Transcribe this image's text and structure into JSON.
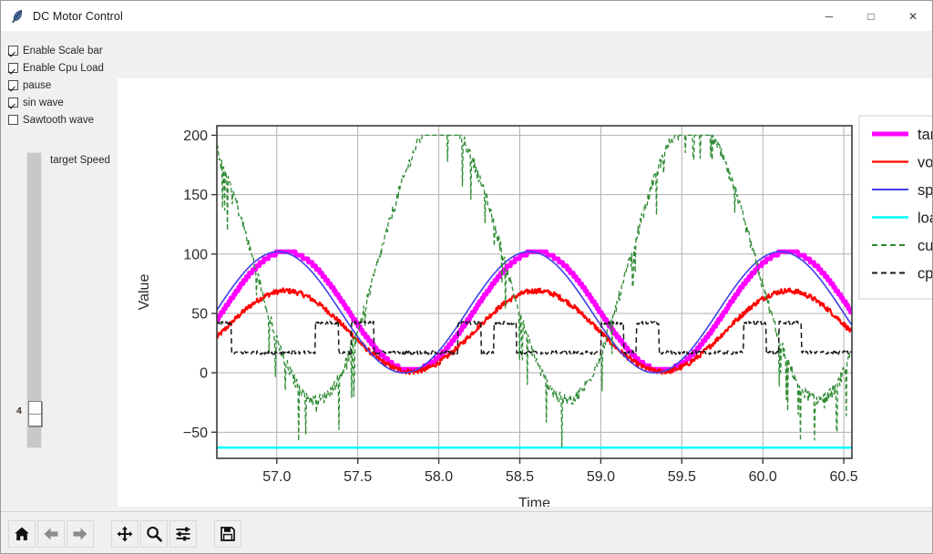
{
  "window": {
    "title": "DC Motor Control",
    "icon": "feather-icon",
    "minimize_glyph": "─",
    "maximize_glyph": "□",
    "close_glyph": "✕",
    "bg": "#f0f0f0"
  },
  "controls": {
    "checkboxes": [
      {
        "label": "Enable Scale bar",
        "checked": true,
        "name": "enable-scale-bar"
      },
      {
        "label": "Enable Cpu Load",
        "checked": true,
        "name": "enable-cpu-load"
      },
      {
        "label": "pause",
        "checked": true,
        "name": "pause"
      },
      {
        "label": "sin wave",
        "checked": true,
        "name": "sin-wave"
      },
      {
        "label": "Sawtooth wave",
        "checked": false,
        "name": "sawtooth-wave"
      }
    ],
    "scale": {
      "label": "target Speed",
      "value": "4",
      "orientation": "vertical"
    }
  },
  "toolbar": {
    "buttons": [
      {
        "name": "home-button",
        "icon": "home-icon",
        "tooltip": "Home"
      },
      {
        "name": "back-button",
        "icon": "arrow-left-icon",
        "tooltip": "Back"
      },
      {
        "name": "forward-button",
        "icon": "arrow-right-icon",
        "tooltip": "Forward"
      },
      {
        "name": "pan-button",
        "icon": "move-icon",
        "tooltip": "Pan"
      },
      {
        "name": "zoom-button",
        "icon": "magnifier-icon",
        "tooltip": "Zoom"
      },
      {
        "name": "configure-subplots-button",
        "icon": "sliders-icon",
        "tooltip": "Configure subplots"
      },
      {
        "name": "save-button",
        "icon": "floppy-disk-icon",
        "tooltip": "Save"
      }
    ]
  },
  "chart_data": {
    "type": "line",
    "title": "",
    "xlabel": "Time",
    "ylabel": "Value",
    "xlim": [
      56.63,
      60.55
    ],
    "ylim": [
      -72,
      208
    ],
    "xticks": [
      57.0,
      57.5,
      58.0,
      58.5,
      59.0,
      59.5,
      60.0,
      60.5
    ],
    "xticklabels": [
      "57.0",
      "57.5",
      "58.0",
      "58.5",
      "59.0",
      "59.5",
      "60.0",
      "60.5"
    ],
    "yticks": [
      -50,
      0,
      50,
      100,
      150,
      200
    ],
    "yticklabels": [
      "−50",
      "0",
      "50",
      "100",
      "150",
      "200"
    ],
    "grid": true,
    "grid_color": "#b0b0b0",
    "legend_position": "upper right (clipped at window edge)",
    "series": [
      {
        "name": "targetSpeed",
        "legend_label": "targetSpeed",
        "color": "#ff00ff",
        "style": "solid",
        "width": 5,
        "shape": "sine-stepped",
        "amplitude": 50,
        "offset": 52,
        "period": 1.55,
        "phase": 0.44,
        "quantize": 3
      },
      {
        "name": "voltage",
        "legend_label": "voltage",
        "color": "#ff0000",
        "style": "solid",
        "width": 2.2,
        "shape": "sine-noisy",
        "amplitude": 34,
        "offset": 35,
        "period": 1.55,
        "phase": 0.44,
        "noise": 2.2
      },
      {
        "name": "speed",
        "legend_label": "speed",
        "color": "#4040e8",
        "style": "solid",
        "width": 1.6,
        "shape": "sine",
        "amplitude": 51,
        "offset": 51,
        "period": 1.55,
        "phase": 0.47
      },
      {
        "name": "loadTorque",
        "legend_label": "loadTorque",
        "color": "#00ffff",
        "style": "solid",
        "width": 2.5,
        "shape": "constant",
        "value": -63
      },
      {
        "name": "current",
        "legend_label": "current",
        "color": "#2e8b33",
        "style": "dashed",
        "width": 1.3,
        "shape": "sine-spiky",
        "amplitude": 118,
        "offset": 95,
        "period": 1.55,
        "phase": -0.18,
        "clip_max": 200,
        "noise": 10
      },
      {
        "name": "cpu_load",
        "legend_label": "cpu_load",
        "color": "#1a1a1a",
        "style": "dashed",
        "width": 1.5,
        "shape": "square-pulse",
        "low": 17,
        "high": 42,
        "pulse_period": 0.22
      }
    ]
  }
}
